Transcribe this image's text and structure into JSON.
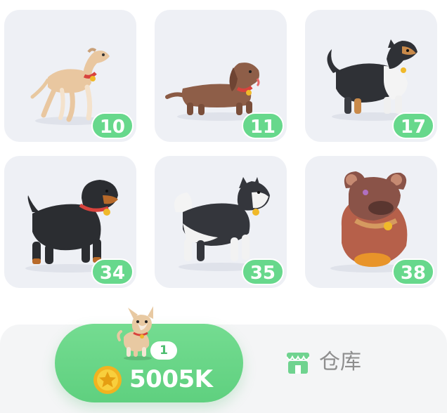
{
  "dog_grid": {
    "cards": [
      {
        "name": "whippet",
        "level": "10"
      },
      {
        "name": "dachshund",
        "level": "11"
      },
      {
        "name": "collie",
        "level": "17"
      },
      {
        "name": "rottweiler",
        "level": "34"
      },
      {
        "name": "husky",
        "level": "35"
      },
      {
        "name": "mud-dog",
        "level": "38"
      }
    ]
  },
  "buy_button": {
    "dog_level": "1",
    "price": "5005K",
    "coin_icon": "gold-coin-star-icon"
  },
  "storage": {
    "label": "仓库",
    "icon": "shop-icon"
  },
  "colors": {
    "accent_green": "#67d88c",
    "card_bg": "#eef0f5",
    "bar_bg": "#f4f5f6"
  }
}
